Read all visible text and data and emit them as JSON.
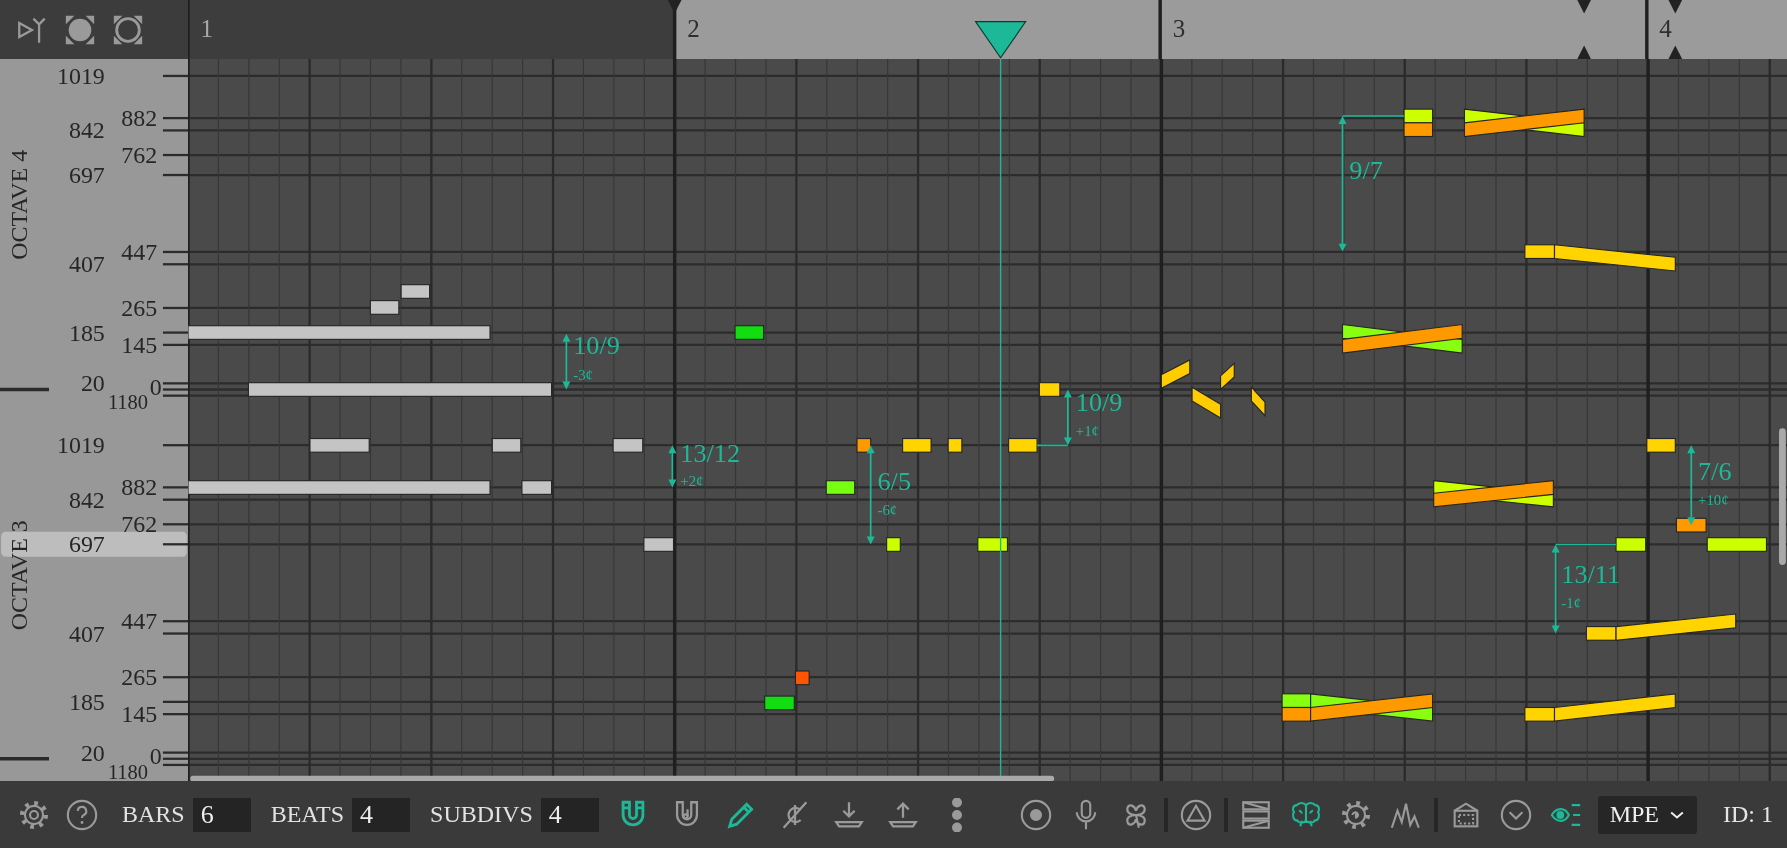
{
  "top_buttons": [
    {
      "on": false
    },
    {
      "on": false
    },
    {
      "on": false
    }
  ],
  "timeline": {
    "bars": [
      {
        "label": "1",
        "in_loop": false
      },
      {
        "label": "2",
        "in_loop": true
      },
      {
        "label": "3",
        "in_loop": true
      },
      {
        "label": "4",
        "in_loop": true
      }
    ]
  },
  "ruler": {
    "octaves": [
      {
        "label": "OCTAVE 4",
        "ticks": [
          {
            "text": "1019",
            "selected": false
          },
          {
            "text": "842",
            "selected": false
          },
          {
            "text": "697",
            "selected": false
          },
          {
            "text": "407",
            "selected": false
          },
          {
            "text": "185",
            "selected": false
          },
          {
            "text": "20",
            "selected": false
          },
          {
            "text": "882",
            "selected": false
          },
          {
            "text": "762",
            "selected": false
          },
          {
            "text": "447",
            "selected": false
          },
          {
            "text": "265",
            "selected": false
          },
          {
            "text": "145",
            "selected": false
          },
          {
            "text": "0",
            "selected": false
          }
        ]
      },
      {
        "label": "OCTAVE 3",
        "ticks": [
          {
            "text": "1019",
            "selected": false
          },
          {
            "text": "842",
            "selected": false
          },
          {
            "text": "697",
            "selected": true
          },
          {
            "text": "407",
            "selected": false
          },
          {
            "text": "185",
            "selected": false
          },
          {
            "text": "20",
            "selected": false
          },
          {
            "text": "1180",
            "selected": false
          },
          {
            "text": "882",
            "selected": false
          },
          {
            "text": "762",
            "selected": false
          },
          {
            "text": "447",
            "selected": false
          },
          {
            "text": "265",
            "selected": false
          },
          {
            "text": "145",
            "selected": false
          },
          {
            "text": "0",
            "selected": false
          }
        ]
      },
      {
        "ticks": [
          {
            "text": "1180",
            "selected": false
          }
        ]
      }
    ]
  },
  "notes": [
    {
      "kind": "step",
      "color": "#c4c4c4"
    },
    {
      "kind": "step",
      "color": "#c4c4c4"
    },
    {
      "kind": "step",
      "color": "#c4c4c4"
    },
    {
      "kind": "step",
      "color": "#c4c4c4"
    },
    {
      "kind": "step",
      "color": "#c4c4c4"
    },
    {
      "kind": "step",
      "color": "#c4c4c4"
    },
    {
      "kind": "step",
      "color": "#c4c4c4"
    },
    {
      "kind": "step",
      "color": "#c4c4c4"
    },
    {
      "kind": "step",
      "color": "#c4c4c4"
    },
    {
      "kind": "step",
      "color": "#c4c4c4"
    },
    {
      "kind": "step",
      "color": "#11dd11"
    },
    {
      "kind": "step",
      "color": "#11dd11"
    },
    {
      "kind": "step",
      "color": "#ff5500"
    },
    {
      "kind": "step",
      "color": "#77ff11"
    },
    {
      "kind": "step",
      "color": "#ff9900"
    },
    {
      "kind": "step",
      "color": "#ffd400"
    },
    {
      "kind": "step",
      "color": "#ffd400"
    },
    {
      "kind": "step",
      "color": "#ccff00"
    },
    {
      "kind": "step",
      "color": "#ccff00"
    },
    {
      "kind": "step",
      "color": "#ffd400"
    },
    {
      "kind": "step",
      "color": "#ffd400"
    },
    {
      "kind": "glide",
      "color": "#ffcc00"
    },
    {
      "kind": "glide",
      "color": "#ffcc00"
    },
    {
      "kind": "glide",
      "color": "#ffcc00"
    },
    {
      "kind": "glide",
      "color": "#ffcc00"
    },
    {
      "kind": "step",
      "color": "#88ff11"
    },
    {
      "kind": "step",
      "color": "#ff9900"
    },
    {
      "kind": "cross_glide",
      "parts": [
        {
          "color": "#88ff11"
        },
        {
          "color": "#ff9900"
        }
      ]
    },
    {
      "kind": "cross_glide",
      "parts": [
        {
          "color": "#88ff11"
        },
        {
          "color": "#ff9900"
        }
      ]
    },
    {
      "kind": "step",
      "color": "#ccff00"
    },
    {
      "kind": "step",
      "color": "#ff9900"
    },
    {
      "kind": "cross_glide",
      "parts": [
        {
          "color": "#ccff00"
        },
        {
          "color": "#ff9900"
        }
      ]
    },
    {
      "kind": "cross_glide",
      "parts": [
        {
          "color": "#ccff00"
        },
        {
          "color": "#ff9900"
        }
      ]
    },
    {
      "kind": "step",
      "color": "#ffd400"
    },
    {
      "kind": "glide",
      "color": "#ffd400"
    },
    {
      "kind": "step",
      "color": "#ffd400"
    },
    {
      "kind": "glide",
      "color": "#ffd400"
    },
    {
      "kind": "step",
      "color": "#ffd400"
    },
    {
      "kind": "glide",
      "color": "#ffd400"
    },
    {
      "kind": "step",
      "color": "#ccff00"
    },
    {
      "kind": "step",
      "color": "#ffd400"
    },
    {
      "kind": "step",
      "color": "#ff9900"
    },
    {
      "kind": "step",
      "color": "#ccff00"
    }
  ],
  "intervals": [
    {
      "ratio": "10/9",
      "cents": "-3¢"
    },
    {
      "ratio": "13/12",
      "cents": "+2¢"
    },
    {
      "ratio": "6/5",
      "cents": "-6¢"
    },
    {
      "ratio": "10/9",
      "cents": "+1¢"
    },
    {
      "ratio": "9/7"
    },
    {
      "ratio": "7/6",
      "cents": "+10¢"
    },
    {
      "ratio": "13/11",
      "cents": "-1¢"
    }
  ],
  "toolbar": {
    "left_buttons": [
      {
        "on": false
      },
      {
        "on": false
      }
    ],
    "fields": [
      {
        "label": "BARS",
        "value": "6"
      },
      {
        "label": "BEATS",
        "value": "4"
      },
      {
        "label": "SUBDIVS",
        "value": "4"
      }
    ],
    "tool_buttons": [
      {
        "on": true
      },
      {
        "on": false
      },
      {
        "on": true
      },
      {
        "on": false
      },
      {
        "on": false
      },
      {
        "on": false
      },
      {
        "on": false
      }
    ],
    "right_groups": [
      [
        {
          "on": false
        },
        {
          "on": false
        },
        {
          "on": false
        }
      ],
      [
        {
          "on": false
        }
      ],
      [
        {
          "on": false
        },
        {
          "on": true
        },
        {
          "on": false
        },
        {
          "on": false
        }
      ],
      [
        {
          "on": false
        },
        {
          "on": false
        },
        {
          "on": true
        }
      ]
    ],
    "mode_dropdown": {
      "value": "MPE"
    },
    "id_label": "ID: 1"
  }
}
